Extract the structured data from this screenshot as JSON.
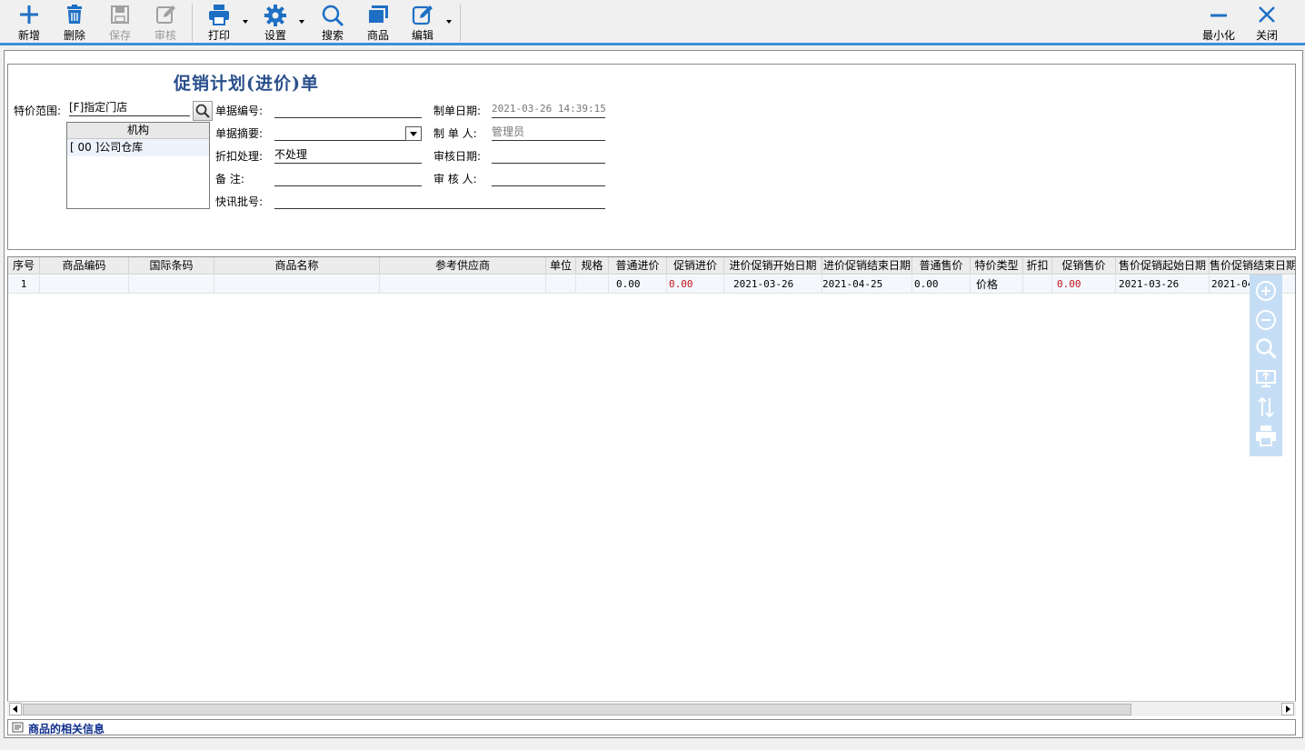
{
  "toolbar": {
    "new": "新增",
    "delete": "删除",
    "save": "保存",
    "audit": "审核",
    "print": "打印",
    "settings": "设置",
    "search": "搜索",
    "goods": "商品",
    "edit": "编辑",
    "minimize": "最小化",
    "close": "关闭"
  },
  "form": {
    "title": "促销计划(进价)单",
    "scope_label": "特价范围:",
    "scope_value": "[F]指定门店",
    "org_header": "机构",
    "org_row": "[ 00 ]公司仓库",
    "doc_no_label": "单据编号:",
    "doc_no": "",
    "summary_label": "单据摘要:",
    "summary": "",
    "discount_label": "折扣处理:",
    "discount": "不处理",
    "remark_label": "备    注:",
    "remark": "",
    "batch_label": "快讯批号:",
    "batch": "",
    "created_date_label": "制单日期:",
    "created_date": "2021-03-26 14:39:15",
    "creator_label": "制 单 人:",
    "creator": "管理员",
    "audit_date_label": "审核日期:",
    "audit_date": "",
    "auditor_label": "审 核 人:",
    "auditor": ""
  },
  "grid": {
    "columns": [
      "序号",
      "商品编码",
      "国际条码",
      "商品名称",
      "参考供应商",
      "单位",
      "规格",
      "普通进价",
      "促销进价",
      "进价促销开始日期",
      "进价促销结束日期",
      "普通售价",
      "特价类型",
      "折扣",
      "促销售价",
      "售价促销起始日期",
      "售价促销结束日期"
    ],
    "rows": [
      {
        "seq": "1",
        "code": "",
        "barcode": "",
        "name": "",
        "supplier": "",
        "unit": "",
        "spec": "",
        "normal_cost": "0.00",
        "promo_cost": "0.00",
        "cost_start": "2021-03-26",
        "cost_end": "2021-04-25",
        "normal_price": "0.00",
        "price_type": "价格",
        "discount": "",
        "promo_price": "0.00",
        "price_start": "2021-03-26",
        "price_end": "2021-04"
      }
    ]
  },
  "side_tools": [
    "zoom-in-icon",
    "zoom-out-icon",
    "search-icon",
    "monitor-icon",
    "sort-icon",
    "printer-icon"
  ],
  "info_bar": {
    "label": "商品的相关信息"
  },
  "colors": {
    "accent": "#3d8fd6",
    "icon": "#1e6fc4",
    "title": "#2a4f8c",
    "red": "#c0141e"
  }
}
